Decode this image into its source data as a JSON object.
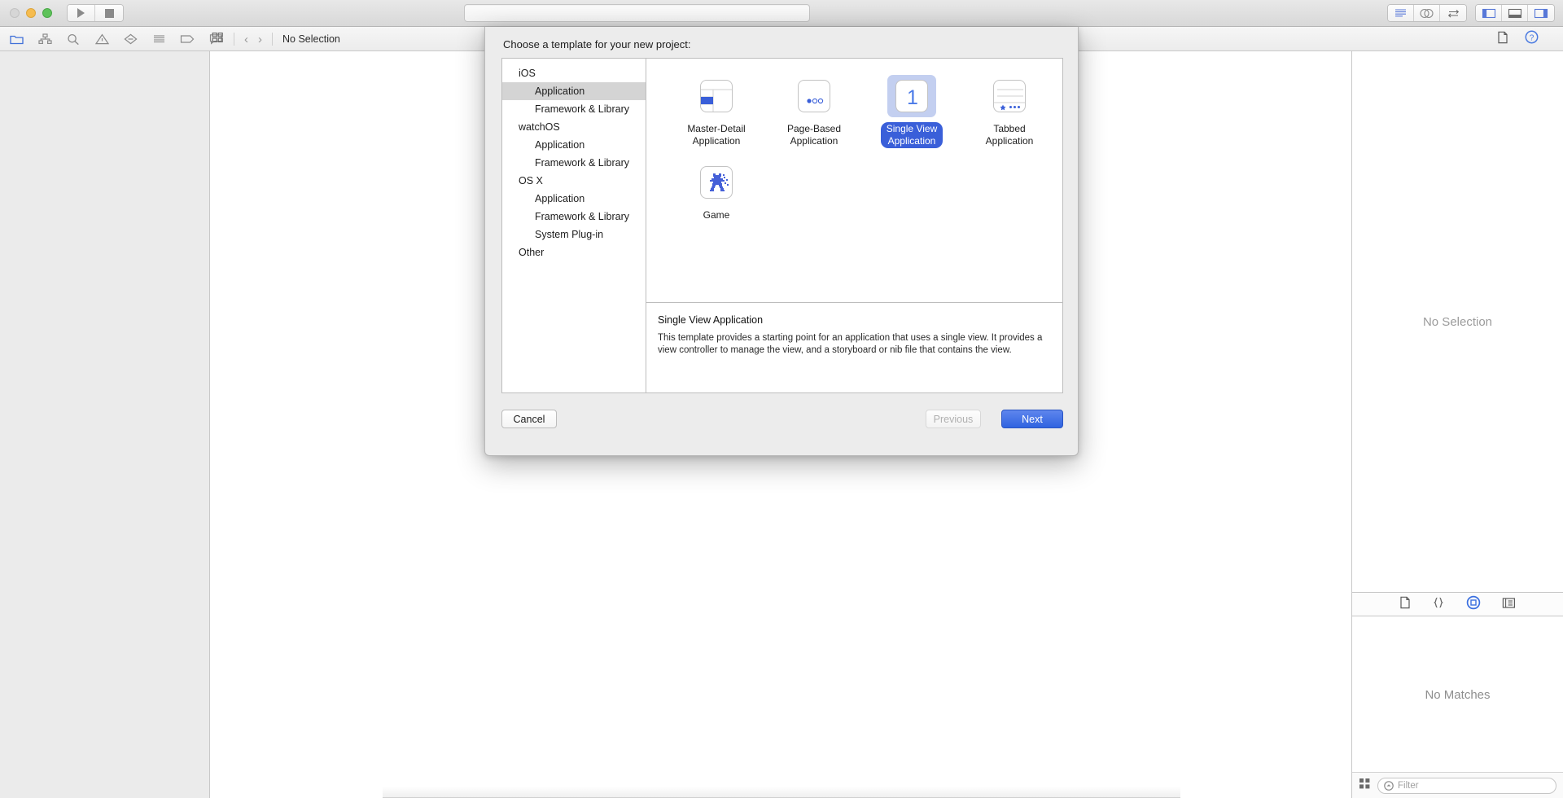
{
  "window": {
    "traffic_lights": [
      "close",
      "minimize",
      "zoom"
    ],
    "run_button": "run-icon",
    "stop_button": "stop-icon",
    "activity_field_value": ""
  },
  "toolbar": {
    "editor_modes": [
      "standard-editor-icon",
      "assistant-editor-icon",
      "version-editor-icon"
    ],
    "view_toggles": [
      "toggle-navigator-icon",
      "toggle-debug-area-icon",
      "toggle-utilities-icon"
    ]
  },
  "navigator_bar": {
    "icons": [
      "project-navigator-icon",
      "symbol-navigator-icon",
      "find-navigator-icon",
      "issue-navigator-icon",
      "test-navigator-icon",
      "debug-navigator-icon",
      "breakpoint-navigator-icon",
      "report-navigator-icon"
    ]
  },
  "breadcrumb": {
    "grid_icon": "related-items-icon",
    "back_chevron": "‹",
    "forward_chevron": "›",
    "label": "No Selection"
  },
  "strip_right": {
    "file_icon": "file-inspector-icon",
    "help_icon": "quick-help-icon"
  },
  "inspector": {
    "no_selection": "No Selection",
    "library_tabs": [
      "file-template-library-icon",
      "code-snippet-library-icon",
      "object-library-icon",
      "media-library-icon"
    ],
    "selected_library_tab": 2,
    "no_matches": "No Matches",
    "filter_placeholder": "Filter",
    "grid_icon": "library-grid-icon"
  },
  "dialog": {
    "title": "Choose a template for your new project:",
    "sidebar": [
      {
        "label": "iOS",
        "type": "group",
        "selected": false
      },
      {
        "label": "Application",
        "type": "item",
        "selected": true
      },
      {
        "label": "Framework & Library",
        "type": "item",
        "selected": false
      },
      {
        "label": "watchOS",
        "type": "group",
        "selected": false
      },
      {
        "label": "Application",
        "type": "item",
        "selected": false
      },
      {
        "label": "Framework & Library",
        "type": "item",
        "selected": false
      },
      {
        "label": "OS X",
        "type": "group",
        "selected": false
      },
      {
        "label": "Application",
        "type": "item",
        "selected": false
      },
      {
        "label": "Framework & Library",
        "type": "item",
        "selected": false
      },
      {
        "label": "System Plug-in",
        "type": "item",
        "selected": false
      },
      {
        "label": "Other",
        "type": "group",
        "selected": false
      }
    ],
    "templates": [
      {
        "label": "Master-Detail\nApplication",
        "line1": "Master-Detail",
        "line2": "Application",
        "icon": "master-detail-icon",
        "selected": false
      },
      {
        "label": "Page-Based Application",
        "line1": "Page-Based",
        "line2": "Application",
        "icon": "page-based-icon",
        "selected": false
      },
      {
        "label": "Single View Application",
        "line1": "Single View",
        "line2": "Application",
        "icon": "single-view-icon",
        "selected": true
      },
      {
        "label": "Tabbed Application",
        "line1": "Tabbed",
        "line2": "Application",
        "icon": "tabbed-icon",
        "selected": false
      },
      {
        "label": "Game",
        "line1": "Game",
        "line2": "",
        "icon": "game-icon",
        "selected": false
      }
    ],
    "description": {
      "title": "Single View Application",
      "body": "This template provides a starting point for an application that uses a single view. It provides a view controller to manage the view, and a storyboard or nib file that contains the view."
    },
    "buttons": {
      "cancel": "Cancel",
      "previous": "Previous",
      "next": "Next"
    },
    "single_view_glyph": "1"
  },
  "colors": {
    "accent_blue": "#3a5fd9",
    "selection_light": "#c3cff0",
    "sidebar_selection": "#d4d4d4",
    "next_button": "#2f63e0"
  }
}
